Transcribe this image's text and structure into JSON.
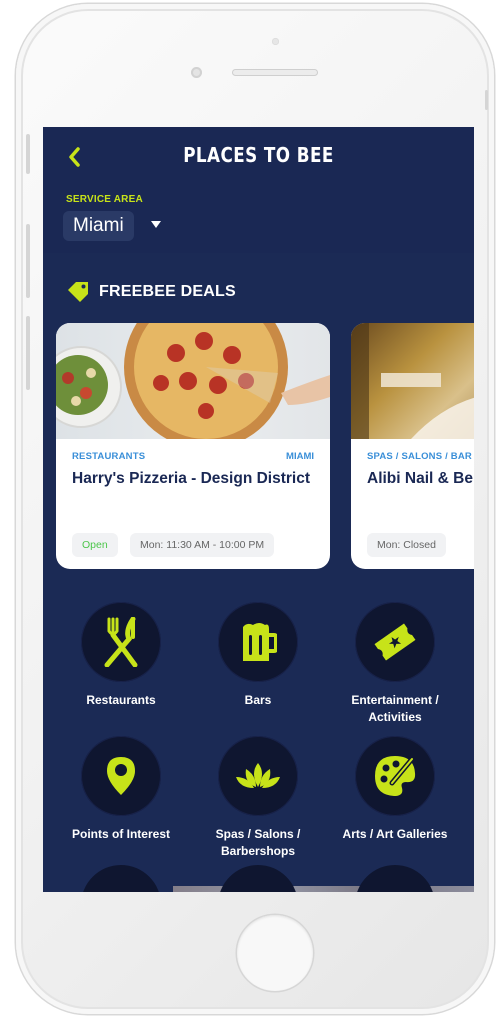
{
  "header": {
    "title": "PLACES TO BEE",
    "back_icon": "chevron-left-icon"
  },
  "service_area": {
    "label": "SERVICE AREA",
    "selected": "Miami",
    "dropdown_icon": "caret-down-icon"
  },
  "deals": {
    "heading": "FREEBEE DEALS",
    "icon": "tag-icon",
    "cards": [
      {
        "category": "RESTAURANTS",
        "location": "MIAMI",
        "name": "Harry's Pizzeria - Design District",
        "status": "Open",
        "hours": "Mon: 11:30 AM - 10:00 PM",
        "image": "pizza-image"
      },
      {
        "category": "SPAS / SALONS / BAR",
        "name": "Alibi Nail & Be",
        "hours": "Mon: Closed",
        "image": "spa-image"
      }
    ]
  },
  "categories": [
    {
      "label": "Restaurants",
      "icon": "fork-knife-icon"
    },
    {
      "label": "Bars",
      "icon": "beer-mug-icon"
    },
    {
      "label": "Entertainment / Activities",
      "icon": "ticket-icon"
    },
    {
      "label": "Points of Interest",
      "icon": "map-pin-icon"
    },
    {
      "label": "Spas / Salons / Barbershops",
      "icon": "lotus-icon"
    },
    {
      "label": "Arts / Art Galleries",
      "icon": "palette-icon"
    }
  ],
  "colors": {
    "background": "#1b2a55",
    "accent": "#c7e319",
    "category_blue": "#3a8fd8",
    "open_green": "#4cc64b"
  }
}
